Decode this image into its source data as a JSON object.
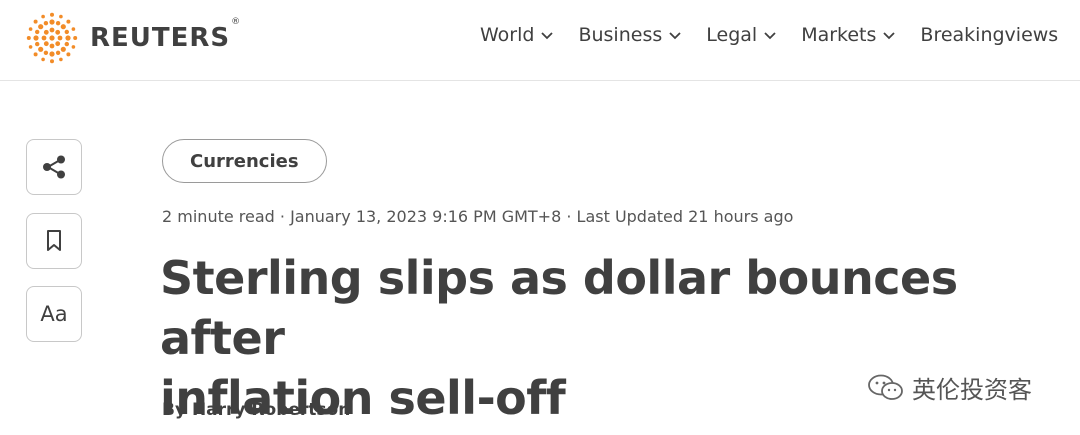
{
  "header": {
    "logo_text": "REUTERS",
    "logo_mark": "®",
    "nav": [
      {
        "label": "World"
      },
      {
        "label": "Business"
      },
      {
        "label": "Legal"
      },
      {
        "label": "Markets"
      },
      {
        "label": "Breakingviews"
      }
    ]
  },
  "tools": {
    "share_icon": "share-icon",
    "bookmark_icon": "bookmark-icon",
    "text_size_label": "Aa"
  },
  "article": {
    "topic": "Currencies",
    "meta": "2 minute read · January 13, 2023 9:16 PM GMT+8 · Last Updated 21 hours ago",
    "headline_line1": "Sterling slips as dollar bounces after",
    "headline_line2": "inflation sell-off",
    "byline": "By Harry Robertson"
  },
  "watermark": {
    "text": "英伦投资客"
  },
  "colors": {
    "brand_orange": "#f28c28",
    "text": "#404040",
    "border": "#c8c8c8"
  }
}
